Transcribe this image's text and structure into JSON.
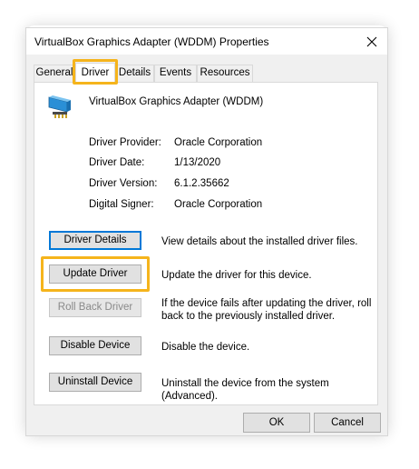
{
  "window": {
    "title": "VirtualBox Graphics Adapter (WDDM) Properties",
    "close_glyph": "✕"
  },
  "tabs": [
    {
      "label": "General"
    },
    {
      "label": "Driver",
      "active": true
    },
    {
      "label": "Details"
    },
    {
      "label": "Events"
    },
    {
      "label": "Resources"
    }
  ],
  "device": {
    "name": "VirtualBox Graphics Adapter (WDDM)",
    "icon": "display-adapter-icon"
  },
  "properties": [
    {
      "label": "Driver Provider:",
      "value": "Oracle Corporation"
    },
    {
      "label": "Driver Date:",
      "value": "1/13/2020"
    },
    {
      "label": "Driver Version:",
      "value": "6.1.2.35662"
    },
    {
      "label": "Digital Signer:",
      "value": "Oracle Corporation"
    }
  ],
  "actions": [
    {
      "label": "Driver Details",
      "description": "View details about the installed driver files."
    },
    {
      "label": "Update Driver",
      "description": "Update the driver for this device."
    },
    {
      "label": "Roll Back Driver",
      "description": "If the device fails after updating the driver, roll back to the previously installed driver.",
      "disabled": true
    },
    {
      "label": "Disable Device",
      "description": "Disable the device."
    },
    {
      "label": "Uninstall Device",
      "description": "Uninstall the device from the system (Advanced)."
    }
  ],
  "footer": {
    "ok_label": "OK",
    "cancel_label": "Cancel"
  },
  "colors": {
    "highlight": "#f5b41c",
    "focus_border": "#0078d7",
    "dialog_bg": "#f0f0f0"
  }
}
